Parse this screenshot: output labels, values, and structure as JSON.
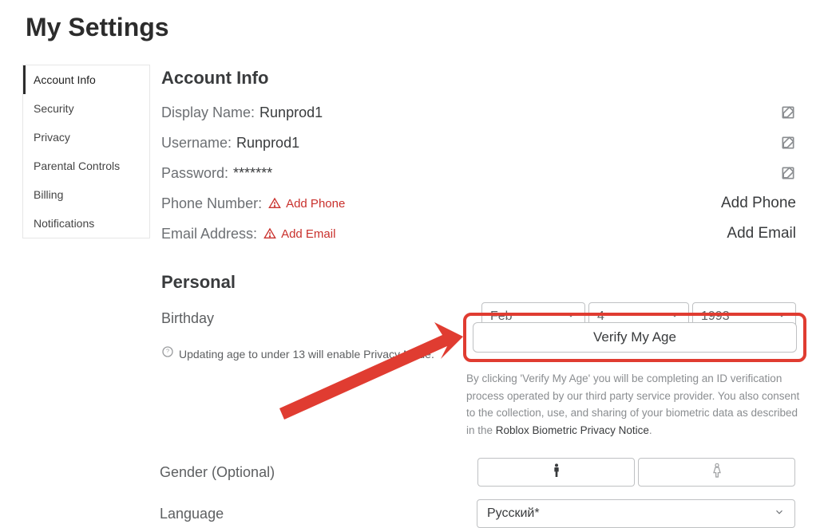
{
  "page_title": "My Settings",
  "sidebar": {
    "items": [
      {
        "label": "Account Info",
        "active": true
      },
      {
        "label": "Security"
      },
      {
        "label": "Privacy"
      },
      {
        "label": "Parental Controls"
      },
      {
        "label": "Billing"
      },
      {
        "label": "Notifications"
      }
    ]
  },
  "account_info": {
    "section_title": "Account Info",
    "display_name_label": "Display Name:",
    "display_name_value": "Runprod1",
    "username_label": "Username:",
    "username_value": "Runprod1",
    "password_label": "Password:",
    "password_value": "*******",
    "phone_label": "Phone Number:",
    "phone_add_link": "Add Phone",
    "phone_right_link": "Add Phone",
    "email_label": "Email Address:",
    "email_add_link": "Add Email",
    "email_right_link": "Add Email"
  },
  "personal": {
    "section_title": "Personal",
    "birthday_label": "Birthday",
    "month": "Feb",
    "day": "4",
    "year": "1993",
    "age_info": "Updating age to under 13 will enable Privacy Mode.",
    "verify_button": "Verify My Age",
    "disclaimer_pre": "By clicking 'Verify My Age' you will be completing an ID verification process operated by our third party service provider. You also consent to the collection, use, and sharing of your biometric data as described in the ",
    "disclaimer_link": "Roblox Biometric Privacy Notice",
    "disclaimer_post": ".",
    "gender_label": "Gender (Optional)",
    "language_label": "Language",
    "language_value": "Русский*"
  },
  "colors": {
    "highlight": "#e03c31",
    "warn": "#c9302c"
  }
}
